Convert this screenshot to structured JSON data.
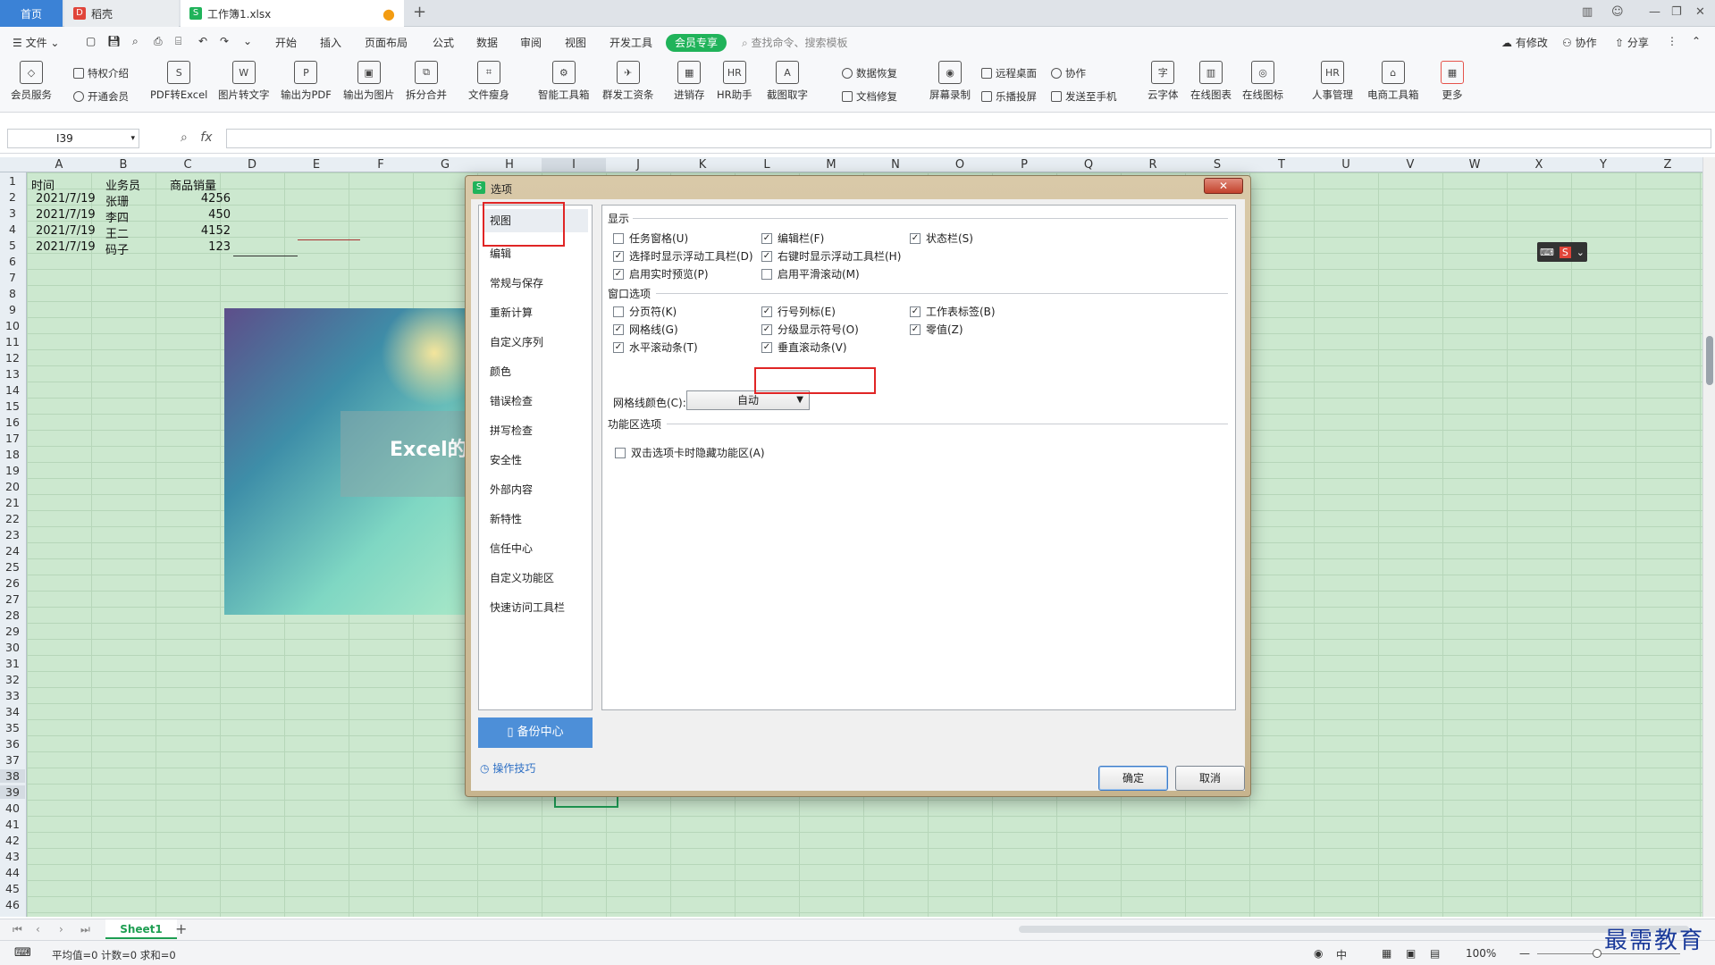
{
  "tabs": {
    "home": "首页",
    "daoke": "稻壳",
    "workbook": "工作簿1.xlsx"
  },
  "menu": {
    "file": "文件",
    "items": [
      "开始",
      "插入",
      "页面布局",
      "公式",
      "数据",
      "审阅",
      "视图",
      "开发工具"
    ],
    "vip": "会员专享",
    "search_placeholder": "查找命令、搜索模板",
    "right": [
      "有修改",
      "协作",
      "分享"
    ]
  },
  "ribbon": {
    "vip_service": "会员服务",
    "privilege": "特权介绍",
    "open_vip": "开通会员",
    "pdf_excel": "PDF转Excel",
    "img_text": "图片转文字",
    "to_pdf": "输出为PDF",
    "to_img": "输出为图片",
    "split_merge": "拆分合并",
    "slim": "文件瘦身",
    "smart_tools": "智能工具箱",
    "mass_pay": "群发工资条",
    "inventory": "进销存",
    "hr_helper": "HR助手",
    "screenshot_ocr": "截图取字",
    "data_recovery": "数据恢复",
    "doc_repair": "文档修复",
    "screen_record": "屏幕录制",
    "remote_desktop": "远程桌面",
    "cast": "乐播投屏",
    "collab": "协作",
    "send_phone": "发送至手机",
    "cloud_font": "云字体",
    "online_chart": "在线图表",
    "online_icon": "在线图标",
    "hr_mgmt": "人事管理",
    "ecom_tools": "电商工具箱",
    "more": "更多"
  },
  "formula_bar": {
    "cell_ref": "I39",
    "fx": "fx"
  },
  "sheet": {
    "columns": [
      "A",
      "B",
      "C",
      "D",
      "E",
      "F",
      "G",
      "H",
      "I",
      "J",
      "K",
      "L",
      "M",
      "N",
      "O",
      "P",
      "Q",
      "R",
      "S",
      "T",
      "U",
      "V",
      "W",
      "X",
      "Y",
      "Z"
    ],
    "rows": [
      "1",
      "2",
      "3",
      "4",
      "5",
      "6",
      "7",
      "8",
      "9",
      "10",
      "11",
      "12",
      "13",
      "14",
      "15",
      "16",
      "17",
      "18",
      "19",
      "20",
      "21",
      "22",
      "23",
      "24",
      "25",
      "26",
      "27",
      "28",
      "29",
      "30",
      "31",
      "32",
      "33",
      "34",
      "35",
      "36",
      "37",
      "38",
      "39",
      "40",
      "41",
      "42",
      "43",
      "44",
      "45",
      "46"
    ],
    "header": [
      "时间",
      "业务员",
      "商品销量"
    ],
    "data": [
      [
        "2021/7/19",
        "张珊",
        "4256"
      ],
      [
        "2021/7/19",
        "李四",
        "450"
      ],
      [
        "2021/7/19",
        "王二",
        "4152"
      ],
      [
        "2021/7/19",
        "码子",
        "123"
      ]
    ],
    "image_title": "Excel的",
    "tab_name": "Sheet1"
  },
  "status": {
    "summary": "平均值=0  计数=0  求和=0",
    "zoom": "100%",
    "input_mode": "中"
  },
  "watermark": "最需教育",
  "dialog": {
    "title": "选项",
    "close": "✕",
    "nav": [
      "视图",
      "编辑",
      "常规与保存",
      "重新计算",
      "自定义序列",
      "颜色",
      "错误检查",
      "拼写检查",
      "安全性",
      "外部内容",
      "新特性",
      "信任中心",
      "自定义功能区",
      "快速访问工具栏"
    ],
    "backup": "备份中心",
    "tips": "操作技巧",
    "sections": {
      "display": "显示",
      "window": "窗口选项",
      "ribbon": "功能区选项"
    },
    "display_opts": [
      {
        "label": "任务窗格(U)",
        "checked": false
      },
      {
        "label": "编辑栏(F)",
        "checked": true
      },
      {
        "label": "状态栏(S)",
        "checked": true
      },
      {
        "label": "选择时显示浮动工具栏(D)",
        "checked": true
      },
      {
        "label": "右键时显示浮动工具栏(H)",
        "checked": true
      },
      {
        "label": "启用实时预览(P)",
        "checked": true
      },
      {
        "label": "启用平滑滚动(M)",
        "checked": false
      }
    ],
    "window_opts": [
      {
        "label": "分页符(K)",
        "checked": false
      },
      {
        "label": "行号列标(E)",
        "checked": true
      },
      {
        "label": "工作表标签(B)",
        "checked": true
      },
      {
        "label": "网格线(G)",
        "checked": true
      },
      {
        "label": "分级显示符号(O)",
        "checked": true
      },
      {
        "label": "零值(Z)",
        "checked": true
      },
      {
        "label": "水平滚动条(T)",
        "checked": true
      },
      {
        "label": "垂直滚动条(V)",
        "checked": true
      }
    ],
    "grid_color_label": "网格线颜色(C):",
    "grid_color_value": "自动",
    "ribbon_opts": [
      {
        "label": "双击选项卡时隐藏功能区(A)",
        "checked": false
      }
    ],
    "ok": "确定",
    "cancel": "取消"
  }
}
